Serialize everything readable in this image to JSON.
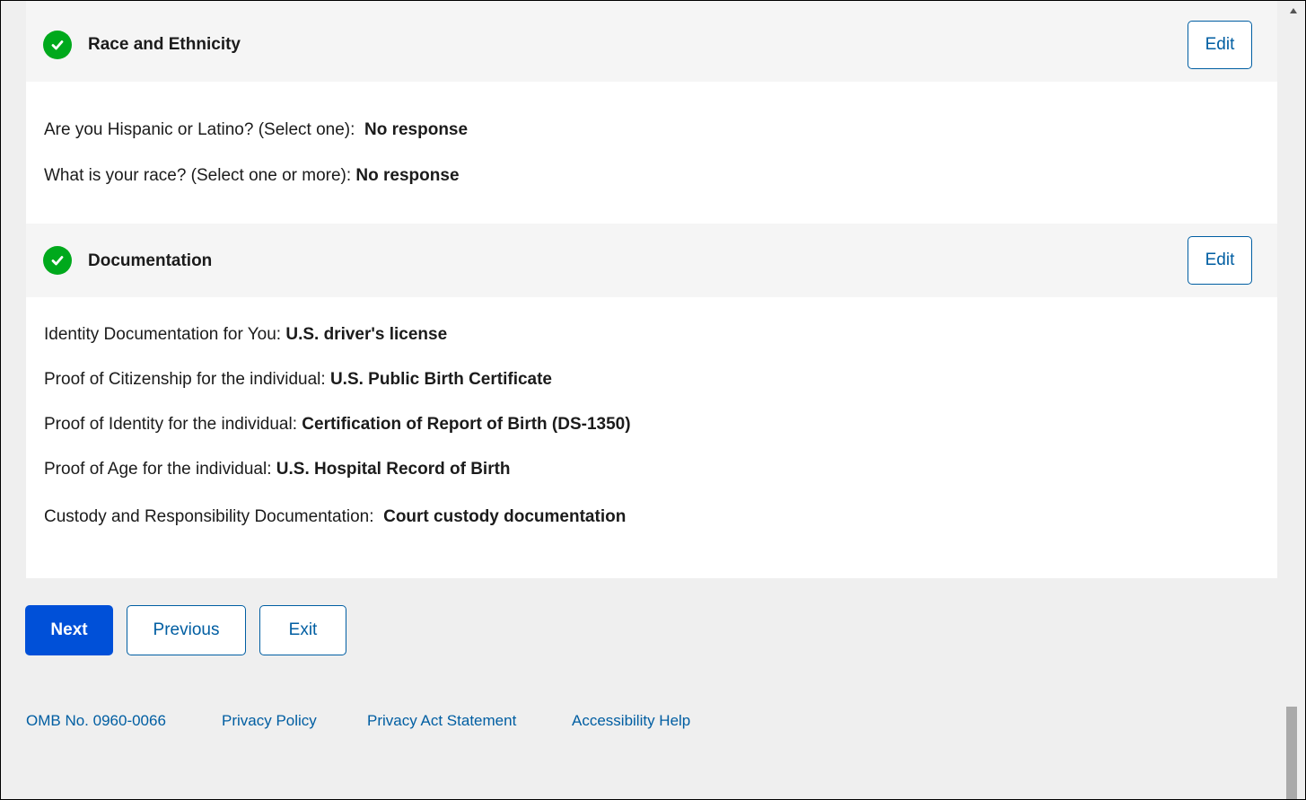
{
  "sections": [
    {
      "title": "Race and Ethnicity",
      "edit_label": "Edit",
      "rows": [
        {
          "label": "Are you Hispanic or Latino? (Select one):",
          "value": "No response"
        },
        {
          "label": "What is your race? (Select one or more):",
          "value": "No response"
        }
      ]
    },
    {
      "title": "Documentation",
      "edit_label": "Edit",
      "rows": [
        {
          "label": "Identity Documentation for You:",
          "value": "U.S. driver's license"
        },
        {
          "label": "Proof of Citizenship for the individual:",
          "value": "U.S. Public Birth Certificate"
        },
        {
          "label": "Proof of Identity for the individual:",
          "value": "Certification of Report of Birth (DS-1350)"
        },
        {
          "label": "Proof of Age for the individual:",
          "value": "U.S. Hospital Record of Birth"
        },
        {
          "label": "Custody and Responsibility Documentation:",
          "value": "Court custody documentation"
        }
      ]
    }
  ],
  "buttons": {
    "next": "Next",
    "previous": "Previous",
    "exit": "Exit"
  },
  "footer": {
    "omb": "OMB No. 0960-0066",
    "privacy_policy": "Privacy Policy",
    "privacy_act": "Privacy Act Statement",
    "accessibility": "Accessibility Help"
  },
  "colors": {
    "check_green": "#00a91c",
    "primary_blue": "#0050d8",
    "link_blue": "#005ea2"
  }
}
